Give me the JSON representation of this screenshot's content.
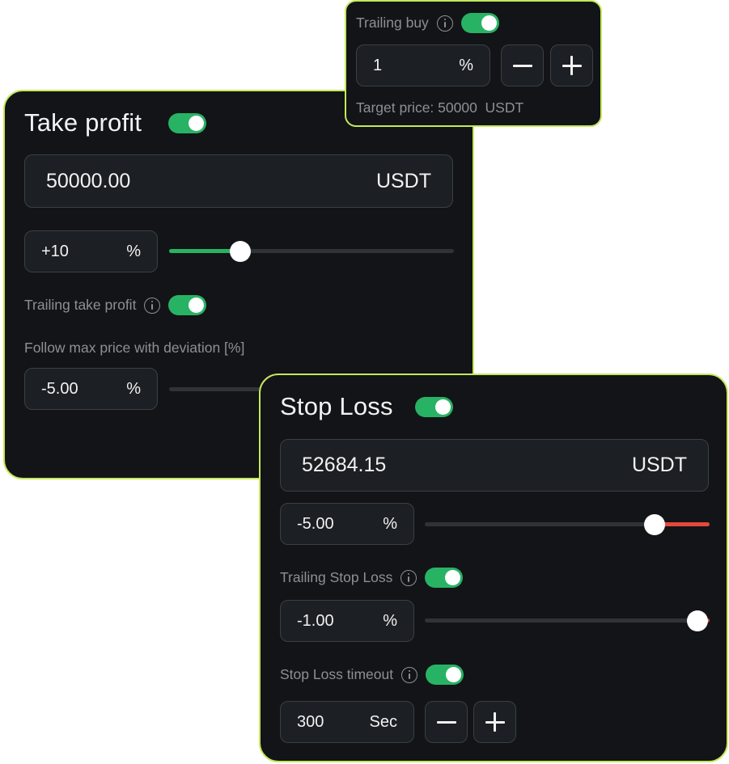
{
  "take_profit": {
    "title": "Take profit",
    "toggle_on": true,
    "price_value": "50000.00",
    "price_unit": "USDT",
    "percent_value": "+10",
    "percent_unit": "%",
    "slider_level": 0.25,
    "trailing_label": "Trailing take profit",
    "trailing_toggle_on": true,
    "deviation_label": "Follow max price with deviation [%]",
    "deviation_value": "-5.00",
    "deviation_unit": "%"
  },
  "trailing_buy": {
    "label": "Trailing buy",
    "toggle_on": true,
    "value": "1",
    "unit": "%",
    "target_text": "Target price: 50000  USDT"
  },
  "stop_loss": {
    "title": "Stop Loss",
    "toggle_on": true,
    "price_value": "52684.15",
    "price_unit": "USDT",
    "percent_value": "-5.00",
    "percent_unit": "%",
    "slider_level": 0.81,
    "trailing_label": "Trailing Stop Loss",
    "trailing_toggle_on": true,
    "trailing_value": "-1.00",
    "trailing_unit": "%",
    "trailing_slider_level": 0.96,
    "timeout_label": "Stop Loss timeout",
    "timeout_toggle_on": true,
    "timeout_value": "300",
    "timeout_unit": "Sec"
  },
  "colors": {
    "card_bg": "#121417",
    "card_border": "#c5e85a",
    "toggle_on": "#28b364",
    "slider_green": "#28b364",
    "slider_red": "#e5483a"
  },
  "icons": [
    "info-icon",
    "minus-icon",
    "plus-icon"
  ]
}
